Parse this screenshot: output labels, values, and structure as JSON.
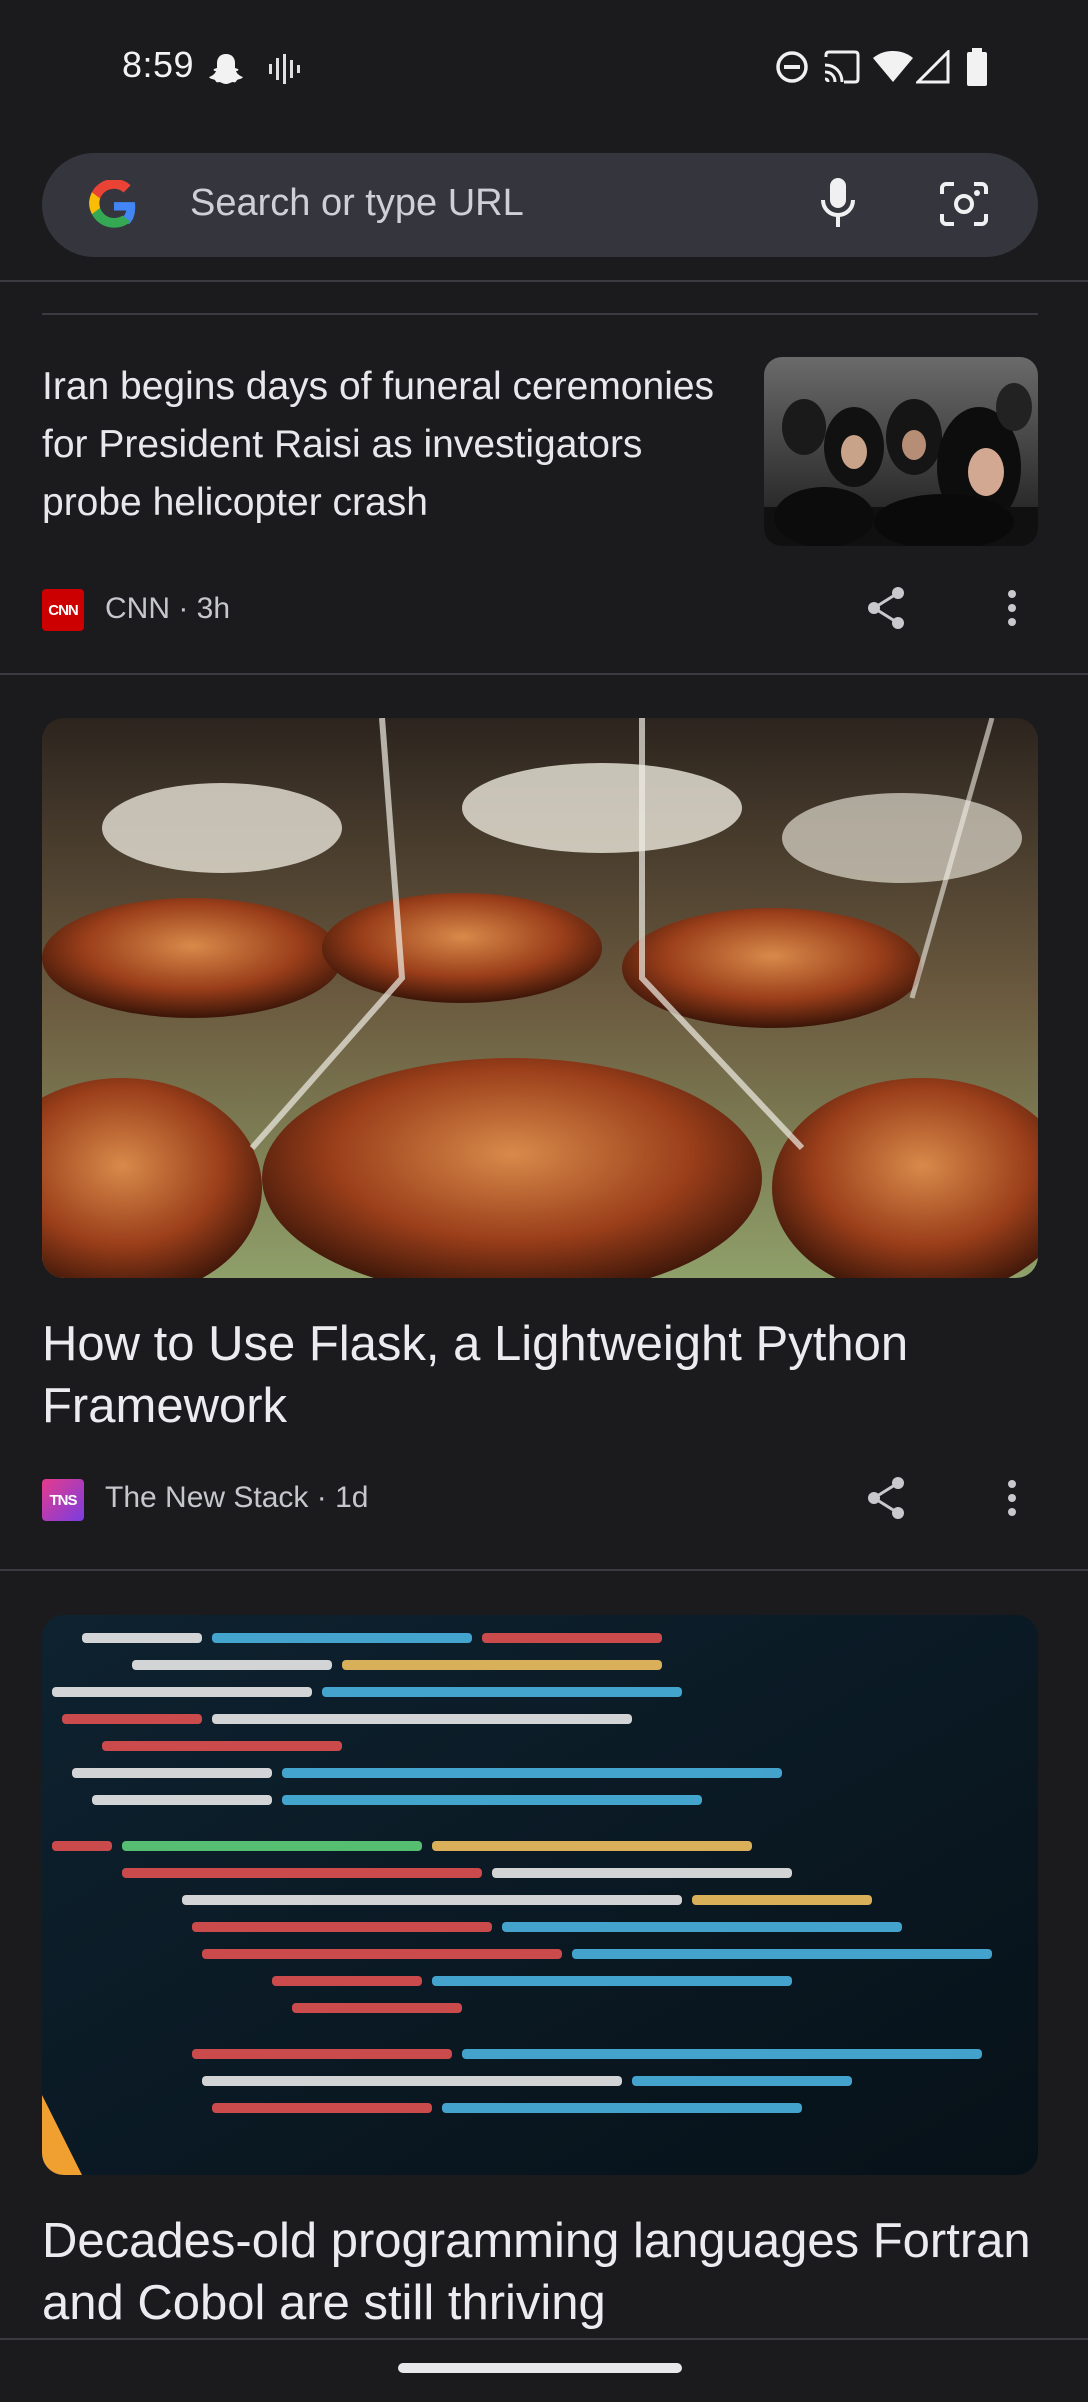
{
  "status_bar": {
    "time": "8:59",
    "left_icons": [
      "snapchat-icon",
      "voice-activity-icon"
    ],
    "right_icons": [
      "do-not-disturb-icon",
      "cast-icon",
      "wifi-icon",
      "signal-icon",
      "battery-icon"
    ]
  },
  "search": {
    "placeholder": "Search or type URL",
    "left_icon": "google-logo",
    "right_icons": [
      "microphone-icon",
      "lens-camera-icon"
    ]
  },
  "feed": [
    {
      "title": "Iran begins days of funeral ceremonies for President Raisi as investigators probe helicopter crash",
      "source_logo_text": "CNN",
      "source_logo_color": "#cc0000",
      "source": "CNN",
      "age": "3h",
      "meta": "CNN · 3h"
    },
    {
      "title": "How to Use Flask, a Lightweight Python Framework",
      "source_logo_text": "TNS",
      "source": "The New Stack",
      "age": "1d",
      "meta": "The New Stack · 1d"
    },
    {
      "title": "Decades-old programming languages Fortran and Cobol are still thriving"
    }
  ],
  "colors": {
    "background": "#1b1b1e",
    "search_bg": "#35353d",
    "divider": "#3a3a40",
    "text_primary": "#e8e8ec",
    "text_secondary": "#c6c7cd"
  }
}
